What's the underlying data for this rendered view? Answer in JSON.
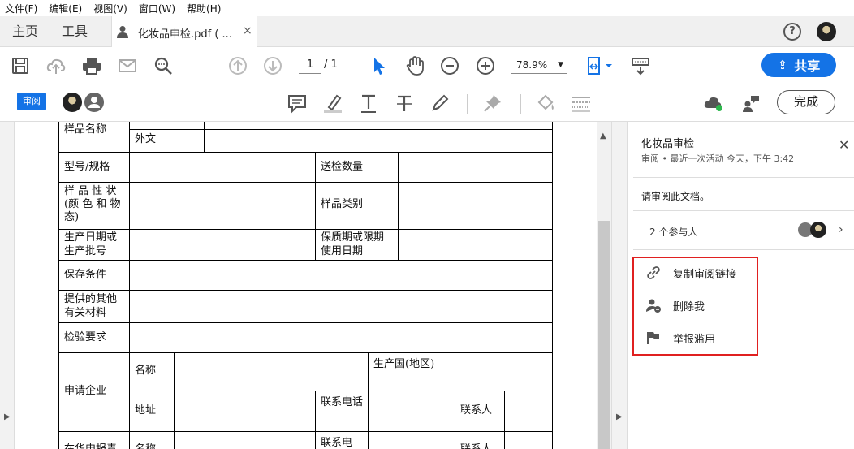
{
  "menubar": {
    "items": [
      "文件(F)",
      "编辑(E)",
      "视图(V)",
      "窗口(W)",
      "帮助(H)"
    ]
  },
  "tabs": {
    "home": "主页",
    "tools": "工具",
    "doc_title": "化妆品申检.pdf ( ...",
    "close": "×"
  },
  "help": "?",
  "toolbar": {
    "page_current": "1",
    "page_total": "/ 1",
    "zoom": "78.9%",
    "share_label": "共享"
  },
  "review_bar": {
    "badge": "审阅",
    "done_label": "完成"
  },
  "form": {
    "sample_name": "样品名称",
    "foreign": "外文",
    "model": "型号/规格",
    "send_qty": "送检数量",
    "nature": "样 品 性 状(颜 色 和 物态)",
    "category": "样品类别",
    "prod_date": "生产日期或生产批号",
    "shelf": "保质期或限期使用日期",
    "storage": "保存条件",
    "other": "提供的其他有关材料",
    "req": "检验要求",
    "company": "申请企业",
    "name": "名称",
    "country": "生产国(地区)",
    "address": "地址",
    "phone": "联系电话",
    "contact": "联系人",
    "agent": "在华申报责",
    "name2": "名称",
    "phone2": "联系电",
    "contact2": "联系人"
  },
  "panel": {
    "title": "化妆品审检",
    "subtitle": "审阅 • 最近一次活动 今天，下午 3:42",
    "message": "请审阅此文档。",
    "participants": "2 个参与人",
    "menu": [
      {
        "icon": "link-icon",
        "label": "复制审阅链接"
      },
      {
        "icon": "remove-person-icon",
        "label": "删除我"
      },
      {
        "icon": "flag-icon",
        "label": "举报滥用"
      }
    ]
  },
  "colors": {
    "accent": "#1473e6",
    "highlight_border": "#e02020"
  }
}
